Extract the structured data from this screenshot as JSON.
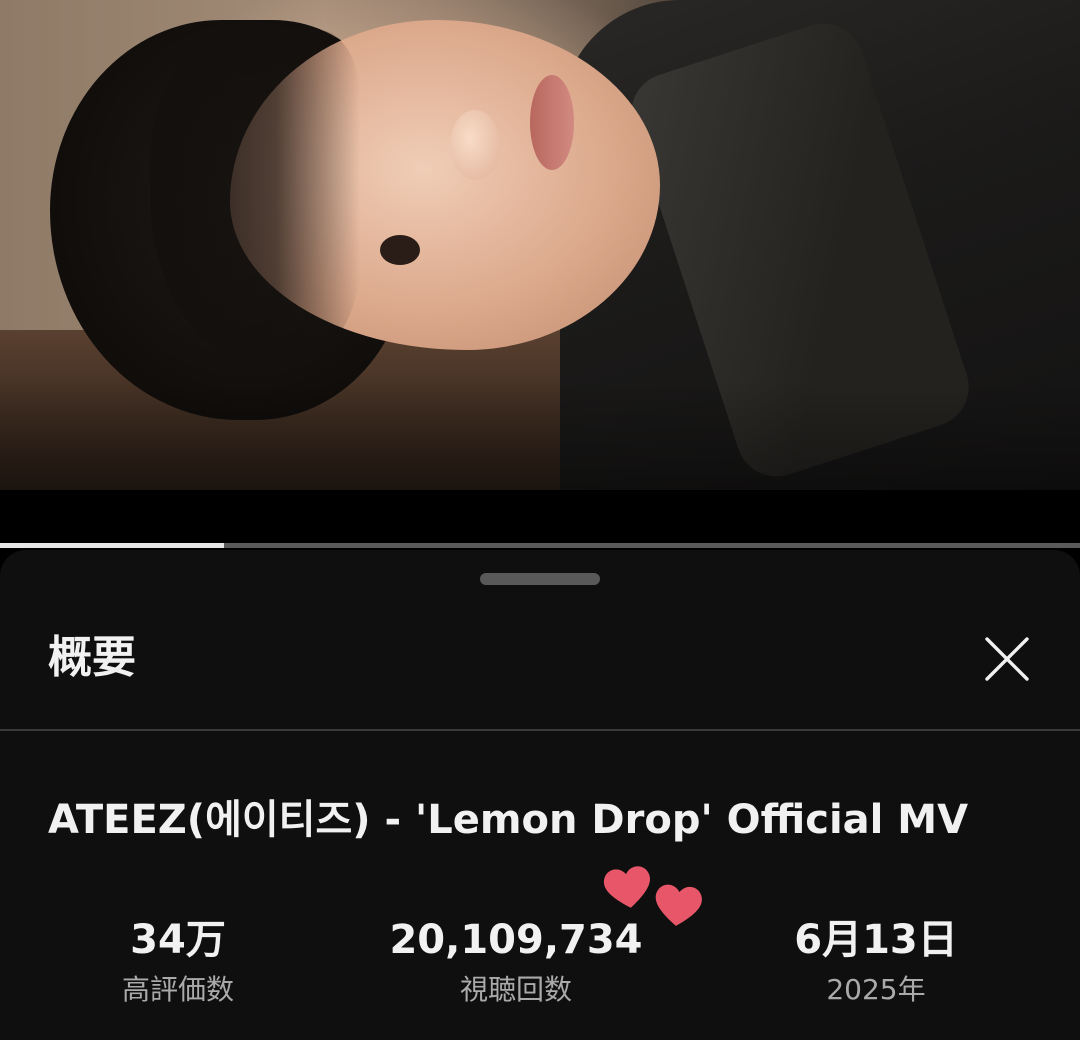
{
  "player": {
    "progress_fraction": 0.207
  },
  "panel": {
    "title": "概要",
    "close_icon": "close-icon"
  },
  "video": {
    "title": "ATEEZ(에이티즈) - 'Lemon Drop' Official MV"
  },
  "stats": [
    {
      "value": "34万",
      "label": "高評価数"
    },
    {
      "value": "20,109,734",
      "label": "視聴回数"
    },
    {
      "value": "6月13日",
      "label": "2025年"
    }
  ],
  "stickers": {
    "icon": "heart-icon",
    "color": "#e8566a"
  },
  "colors": {
    "background": "#000000",
    "sheet": "#0f0f0f",
    "text_primary": "#f1f1f1",
    "text_secondary": "#aaaaaa"
  }
}
